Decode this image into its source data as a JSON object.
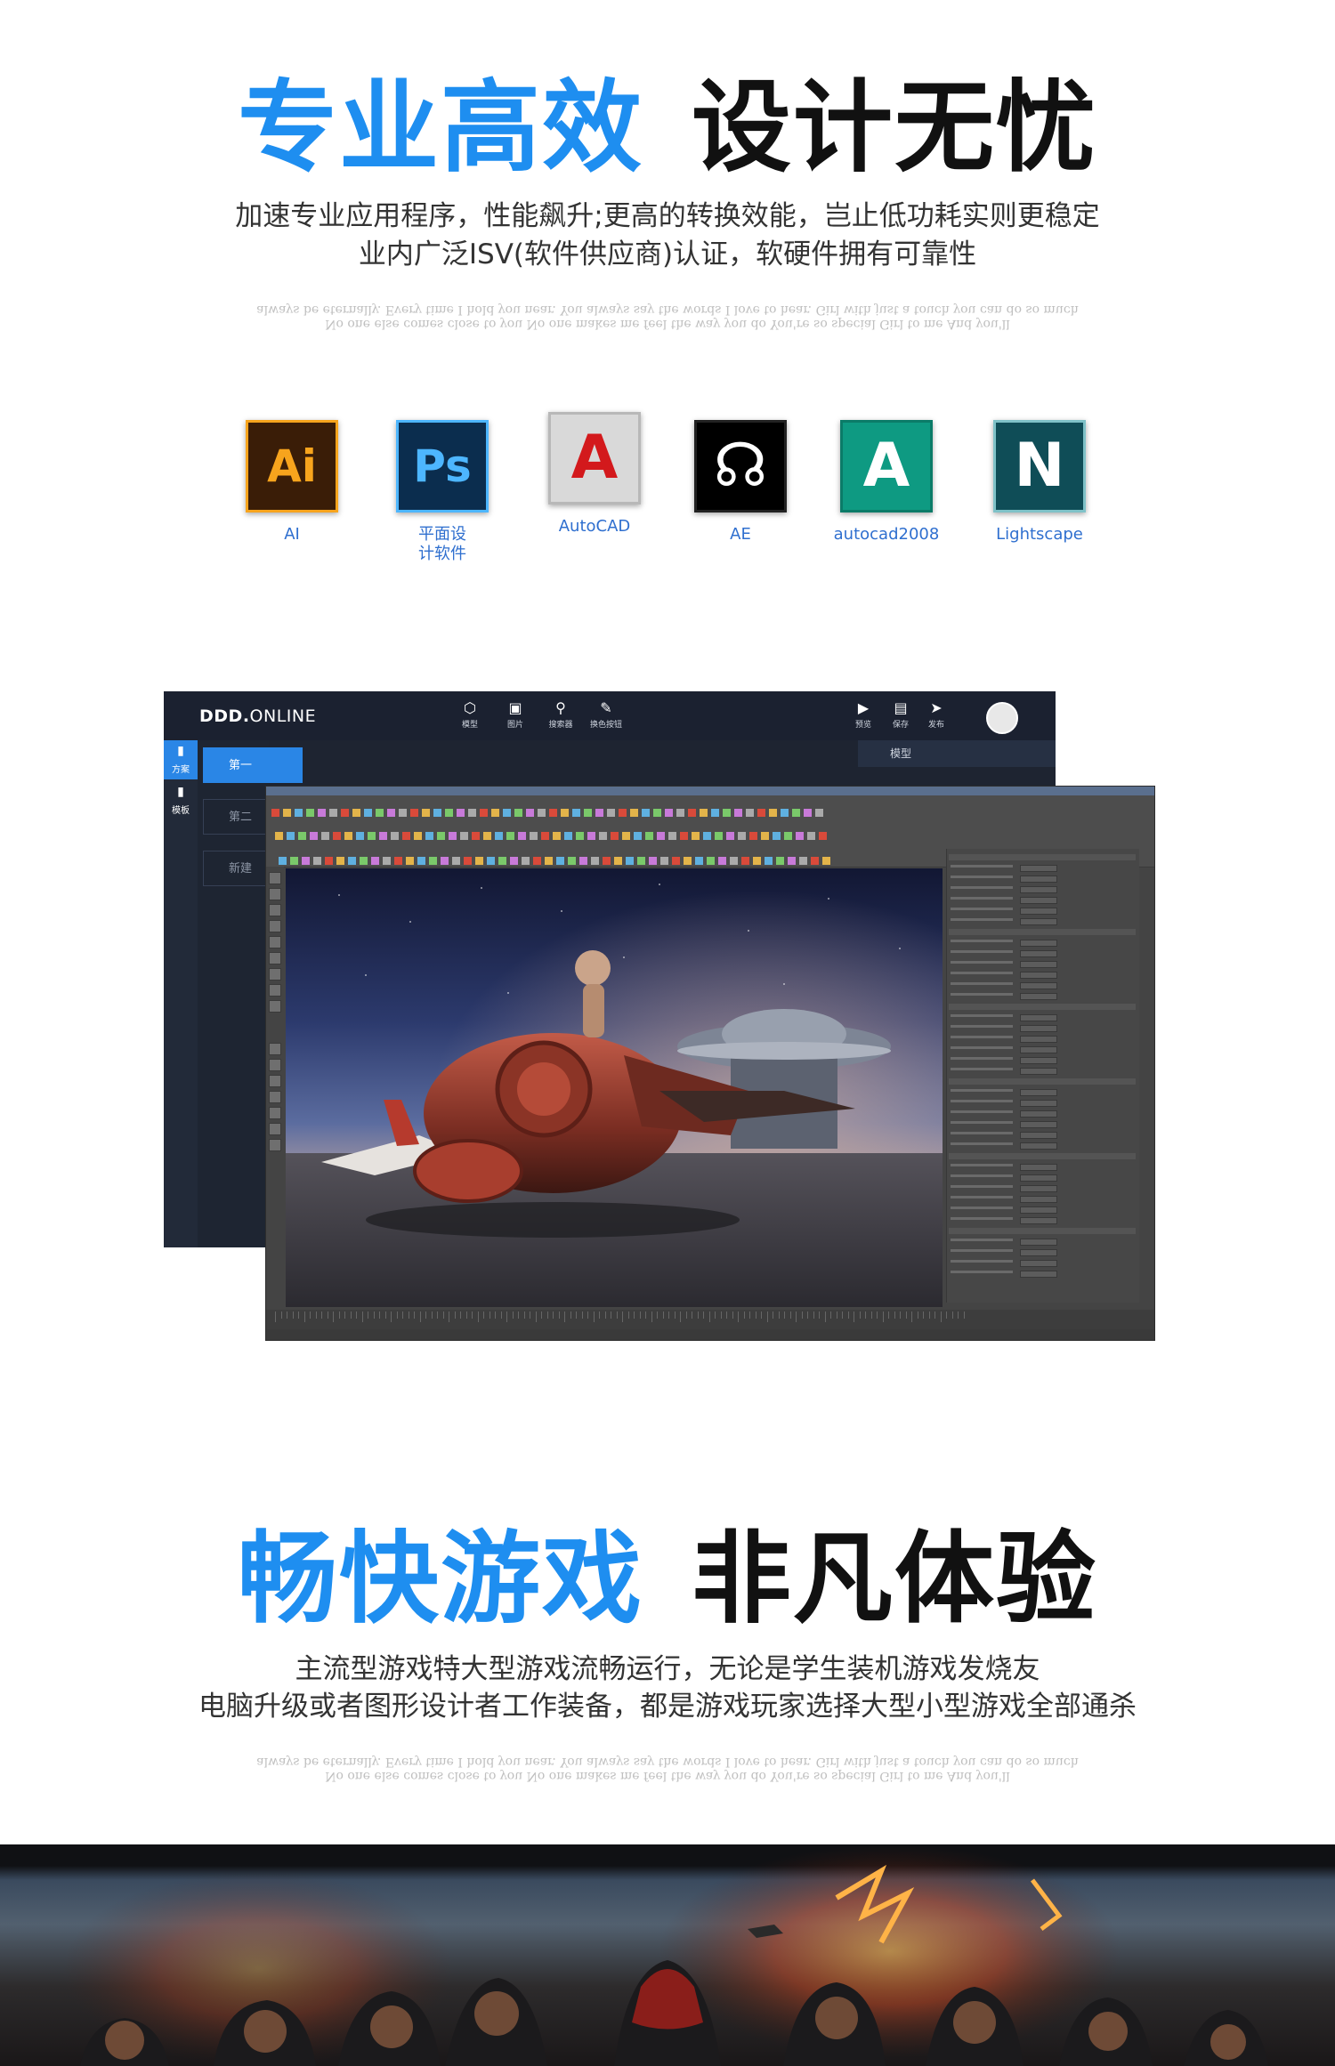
{
  "section1": {
    "heading_blue": "专业高效",
    "heading_black": "设计无忧",
    "line1": "加速专业应用程序，性能飙升;更高的转换效能，岂止低功耗实则更稳定",
    "line2": "业内广泛ISV(软件供应商)认证，软硬件拥有可靠性",
    "mirror1": "always be eternally. Every time I hold you near. You always say the words I love to hear. Girl with just a touch you can do so much",
    "mirror2": "No one else comes close to you No one makes me feel the way you do You're so special Girl to me And you'll"
  },
  "software": [
    {
      "label": "AI",
      "icon": "illustrator-icon",
      "glyph": "Ai",
      "bg": "#3a1d07",
      "fg": "#f7a41d",
      "border": "#f7a41d"
    },
    {
      "label": "平面设计软件",
      "icon": "photoshop-icon",
      "glyph": "Ps",
      "bg": "#0b2d4e",
      "fg": "#4db6ff",
      "border": "#4db6ff"
    },
    {
      "label": "AutoCAD",
      "icon": "autocad-icon",
      "glyph": "A",
      "bg": "#d9d9d9",
      "fg": "#d3191c",
      "border": "#b8b8b8"
    },
    {
      "label": "AE",
      "icon": "after-effects-head-icon",
      "glyph": "☊",
      "bg": "#000000",
      "fg": "#ffffff",
      "border": "#222222"
    },
    {
      "label": "autocad2008",
      "icon": "autocad2008-icon",
      "glyph": "A",
      "bg": "#0e9a82",
      "fg": "#ffffff",
      "border": "#0b7b68"
    },
    {
      "label": "Lightscape",
      "icon": "lightscape-icon",
      "glyph": "N",
      "bg": "#0f4d57",
      "fg": "#ffffff",
      "border": "#7fc2c8"
    }
  ],
  "app": {
    "logo_bold": "DDD.",
    "logo_rest": "ONLINE",
    "top_buttons": [
      {
        "label": "模型",
        "icon": "cube-icon",
        "glyph": "⬡"
      },
      {
        "label": "图片",
        "icon": "image-icon",
        "glyph": "▣"
      },
      {
        "label": "搜索器",
        "icon": "search-icon",
        "glyph": "⚲"
      },
      {
        "label": "换色按钮",
        "icon": "palette-icon",
        "glyph": "✎"
      }
    ],
    "right_buttons": [
      {
        "label": "预览",
        "icon": "play-icon",
        "glyph": "▶"
      },
      {
        "label": "保存",
        "icon": "save-icon",
        "glyph": "▤"
      },
      {
        "label": "发布",
        "icon": "send-icon",
        "glyph": "➤"
      }
    ],
    "rail": [
      {
        "label": "方案",
        "icon": "document-icon"
      },
      {
        "label": "模板",
        "icon": "file-icon"
      }
    ],
    "panel_items": [
      "第一",
      "第二",
      "新建"
    ],
    "right_head": "模型"
  },
  "game_section": {
    "heading_blue": "畅快游戏",
    "heading_black": "非凡体验",
    "line1": "主流型游戏特大型游戏流畅运行，无论是学生装机游戏发烧友",
    "line2": "电脑升级或者图形设计者工作装备，都是游戏玩家选择大型小型游戏全部通杀",
    "mirror1": "always be eternally. Every time I hold you near. You always say the words I love to hear. Girl with just a touch you can do so much",
    "mirror2": "No one else comes close to you No one makes me feel the way you do You're so special Girl to me And you'll"
  }
}
